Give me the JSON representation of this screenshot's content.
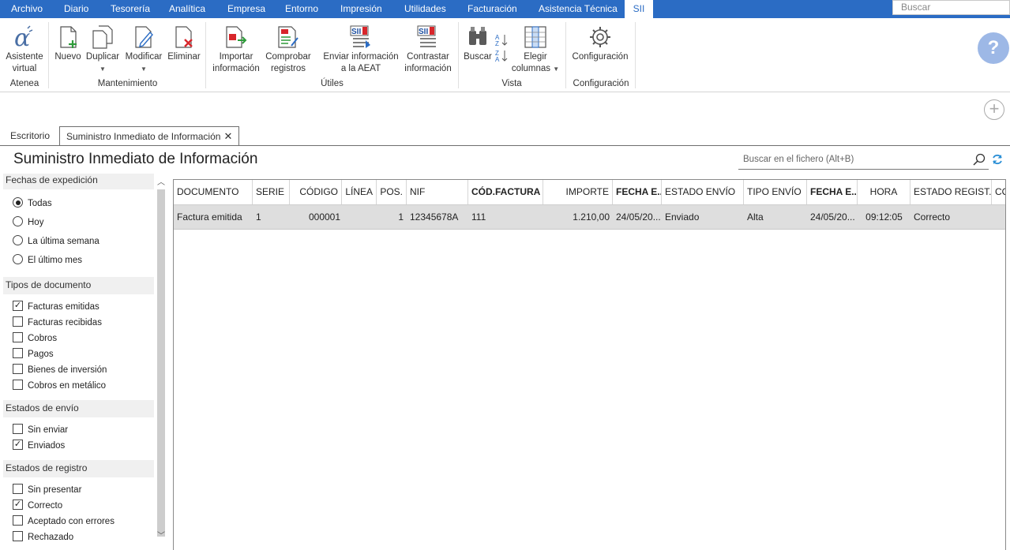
{
  "menu": {
    "items": [
      "Archivo",
      "Diario",
      "Tesorería",
      "Analítica",
      "Empresa",
      "Entorno",
      "Impresión",
      "Utilidades",
      "Facturación",
      "Asistencia Técnica",
      "SII"
    ],
    "active": "SII",
    "search_placeholder": "Buscar"
  },
  "ribbon": {
    "atenea": {
      "btn1": "Asistente",
      "btn2": "virtual",
      "group": "Atenea"
    },
    "mantenimiento": {
      "nuevo": "Nuevo",
      "duplicar": "Duplicar",
      "modificar": "Modificar",
      "eliminar": "Eliminar",
      "group": "Mantenimiento"
    },
    "utiles": {
      "importar1": "Importar",
      "importar2": "información",
      "comprobar1": "Comprobar",
      "comprobar2": "registros",
      "enviar1": "Enviar información",
      "enviar2": "a la AEAT",
      "contrastar1": "Contrastar",
      "contrastar2": "información",
      "group": "Útiles"
    },
    "vista": {
      "buscar": "Buscar",
      "elegir1": "Elegir",
      "elegir2": "columnas",
      "group": "Vista"
    },
    "configuracion": {
      "btn": "Configuración",
      "group": "Configuración"
    },
    "help_glyph": "?",
    "plus_glyph": "+"
  },
  "tabs": {
    "escritorio": "Escritorio",
    "sii": "Suministro Inmediato de Información",
    "close_glyph": "✕"
  },
  "page": {
    "title": "Suministro Inmediato de Información",
    "search_placeholder": "Buscar en el fichero (Alt+B)"
  },
  "filters": {
    "fechas": {
      "title": "Fechas de expedición",
      "options": [
        "Todas",
        "Hoy",
        "La última semana",
        "El último mes"
      ],
      "selected": "Todas"
    },
    "tipos": {
      "title": "Tipos de documento",
      "options": [
        "Facturas emitidas",
        "Facturas recibidas",
        "Cobros",
        "Pagos",
        "Bienes de inversión",
        "Cobros en metálico"
      ],
      "checked": [
        true,
        false,
        false,
        false,
        false,
        false
      ]
    },
    "envio": {
      "title": "Estados de envío",
      "options": [
        "Sin enviar",
        "Enviados"
      ],
      "checked": [
        false,
        true
      ]
    },
    "registro": {
      "title": "Estados de registro",
      "options": [
        "Sin presentar",
        "Correcto",
        "Aceptado con errores",
        "Rechazado"
      ],
      "checked": [
        false,
        true,
        false,
        false
      ]
    },
    "check_glyph": "✓"
  },
  "grid": {
    "headers": [
      "DOCUMENTO",
      "SERIE",
      "CÓDIGO",
      "LÍNEA",
      "POS.",
      "NIF",
      "CÓD.FACTURA",
      "IMPORTE",
      "FECHA E...",
      "ESTADO ENVÍO",
      "TIPO ENVÍO",
      "FECHA E...",
      "HORA",
      "ESTADO REGIST...",
      "CO"
    ],
    "rows": [
      [
        "Factura emitida",
        "1",
        "000001",
        "",
        "1",
        "12345678A",
        "111",
        "1.210,00",
        "24/05/20...",
        "Enviado",
        "Alta",
        "24/05/20...",
        "09:12:05",
        "Correcto",
        ""
      ]
    ]
  },
  "colors": {
    "menubar": "#2b6cc4",
    "selected_row": "#dedede",
    "help": "#9db8e6"
  }
}
